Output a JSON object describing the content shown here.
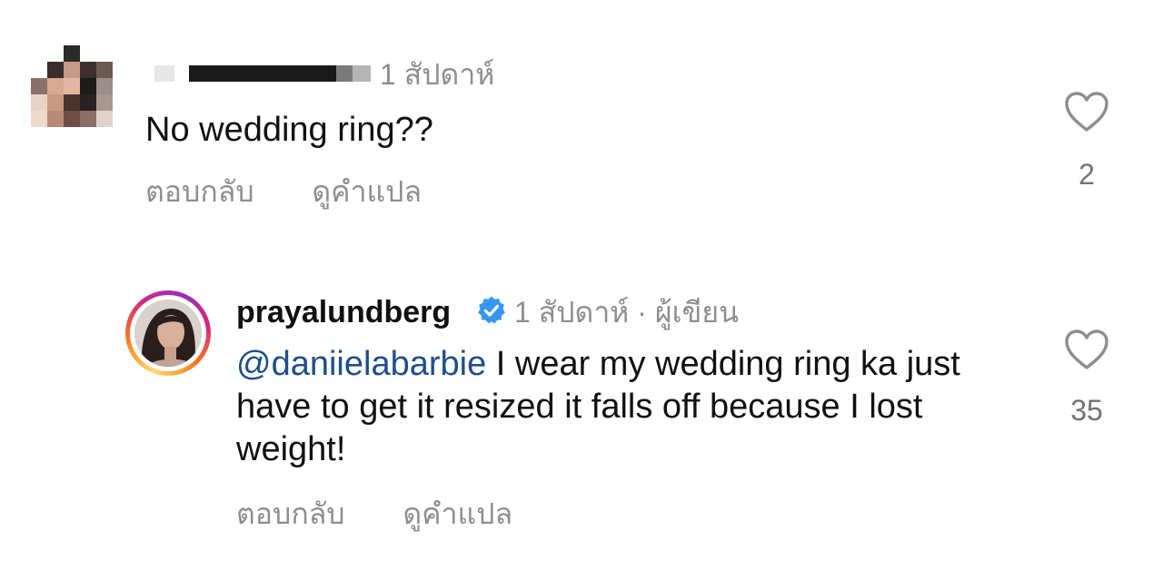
{
  "comments": [
    {
      "time": "1 สัปดาห์",
      "text": "No wedding ring??",
      "actions": {
        "reply": "ตอบกลับ",
        "translate": "ดูคำแปล"
      },
      "likes": "2",
      "avatar_icon": "pixelated-avatar"
    },
    {
      "username": "prayalundberg",
      "verified": true,
      "time": "1 สัปดาห์",
      "separator": "·",
      "author_badge": "ผู้เขียน",
      "mention": "@daniielabarbie",
      "text": " I wear my wedding ring ka just have to get it resized it falls off because I lost weight!",
      "actions": {
        "reply": "ตอบกลับ",
        "translate": "ดูคำแปล"
      },
      "likes": "35",
      "avatar_icon": "profile-photo"
    }
  ],
  "icons": {
    "like": "heart-outline-icon",
    "verified": "verified-badge-icon"
  },
  "colors": {
    "text": "#111111",
    "muted": "#8e8e8e",
    "mention": "#1f4e8c",
    "verified": "#3797f0",
    "story_ring_start": "#feda75",
    "story_ring_end": "#d62976"
  }
}
